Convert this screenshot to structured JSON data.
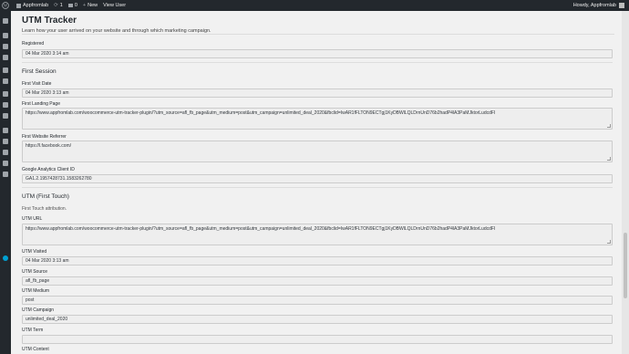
{
  "admin_bar": {
    "site_name": "Appfromlab",
    "updates_count": "1",
    "comments_count": "0",
    "new_label": "New",
    "view_user_label": "View User",
    "howdy": "Howdy, Appfromlab"
  },
  "page": {
    "title": "UTM Tracker",
    "description": "Learn how your user arrived on your website and through which marketing campaign."
  },
  "registered": {
    "label": "Registered",
    "value": "04 Mar 2020 3:14 am"
  },
  "first_session": {
    "heading": "First Session",
    "visit_date_label": "First Visit Date",
    "visit_date_value": "04 Mar 2020 3:13 am",
    "landing_page_label": "First Landing Page",
    "landing_page_value": "https://www.appfromlab.com/woocommerce-utm-tracker-plugin/?utm_source=afl_fb_page&utm_medium=post&utm_campaign=unlimited_deal_2020&fbclid=IwAR1fFLTON9ECTgj1KyDBWlLQLDrnUnD76b2hadP4lA3PaMJktorLudcdFI",
    "referrer_label": "First Website Referrer",
    "referrer_value": "https://l.facebook.com/",
    "ga_label": "Google Analytics Client ID",
    "ga_value": "GA1.2.1957428731.1583262780"
  },
  "utm": {
    "heading": "UTM (First Touch)",
    "note": "First Touch attribution.",
    "url_label": "UTM URL",
    "url_value": "https://www.appfromlab.com/woocommerce-utm-tracker-plugin/?utm_source=afl_fb_page&utm_medium=post&utm_campaign=unlimited_deal_2020&fbclid=IwAR1fFLTON9ECTgj1KyDBWlLQLDrnUnD76b2hadP4lA3PaMJktorLudcdFI",
    "visited_label": "UTM Visited",
    "visited_value": "04 Mar 2020 3:13 am",
    "source_label": "UTM Source",
    "source_value": "afl_fb_page",
    "medium_label": "UTM Medium",
    "medium_value": "post",
    "campaign_label": "UTM Campaign",
    "campaign_value": "unlimited_deal_2020",
    "term_label": "UTM Term",
    "term_value": "",
    "content_label": "UTM Content"
  },
  "icons": [
    "wordpress-icon",
    "home-icon",
    "update-icon",
    "comment-icon",
    "plus-icon",
    "dashboard-icon",
    "pin-icon",
    "media-icon",
    "pages-icon",
    "comments-icon",
    "woocommerce-icon",
    "products-icon",
    "analytics-icon",
    "appearance-icon",
    "plugins-icon",
    "users-icon",
    "tools-icon",
    "settings-icon",
    "collapse-icon"
  ]
}
